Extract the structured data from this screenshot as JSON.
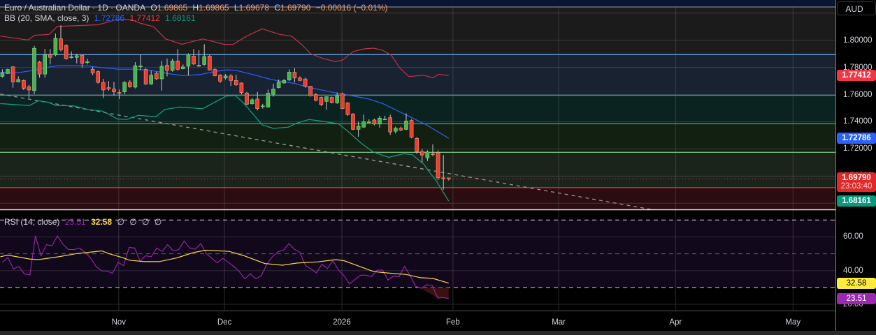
{
  "header": {
    "symbol": "Euro / Australian Dollar · 1D · OANDA",
    "o_label": "O",
    "o": "1.69865",
    "h_label": "H",
    "h": "1.69865",
    "l_label": "L",
    "l": "1.69678",
    "c_label": "C",
    "c": "1.69790",
    "change": "−0.00016 (−0.01%)"
  },
  "bb_legend": {
    "label": "BB (20, SMA, close, 3)",
    "basis": "1.72786",
    "upper": "1.77412",
    "lower": "1.68161"
  },
  "rsi_legend": {
    "label": "RSI (14, close)",
    "rsi": "23.51",
    "ma": "32.58",
    "extra": [
      "∅",
      "∅",
      "∅",
      "∅"
    ]
  },
  "price_axis": {
    "currency": "AUD",
    "ticks": [
      "1.80000",
      "1.78000",
      "1.76000",
      "1.74000",
      "1.72000",
      "1.70000"
    ],
    "tick_values": [
      1.8,
      1.78,
      1.76,
      1.74,
      1.72,
      1.7
    ],
    "badges": [
      {
        "value": "1.77412",
        "color": "#f23645"
      },
      {
        "value": "1.72786",
        "color": "#2962ff"
      },
      {
        "value": "1.69790",
        "countdown": "23:03:40",
        "color": "#e02a2a"
      },
      {
        "value": "1.68161",
        "color": "#089981"
      }
    ]
  },
  "rsi_axis": {
    "ticks": [
      "60.00",
      "40.00",
      "20.00"
    ],
    "tick_values": [
      60,
      40,
      20
    ],
    "badges": [
      {
        "value": "32.58",
        "color": "#ffeb3b",
        "text_color": "#000000"
      },
      {
        "value": "23.51",
        "color": "#9c27b0",
        "text_color": "#ffffff"
      }
    ]
  },
  "time_axis": {
    "labels": [
      "Nov",
      "Dec",
      "2026",
      "Feb",
      "Mar",
      "Apr",
      "May"
    ],
    "label_bar_index": [
      21.9,
      41.8,
      63.9,
      84.8,
      104.7,
      126.7,
      148.8
    ]
  },
  "colors": {
    "up": "#4caf50",
    "down": "#f23a2a",
    "wick": "#c8c8c8",
    "upper": "#c2334a",
    "basis": "#2962ff",
    "lower": "#16a085",
    "rsi": "#9c27b0",
    "rsi_ma": "#f5d547"
  },
  "chart_data": {
    "type": "candlestick",
    "title": "Euro / Australian Dollar · 1D · OANDA",
    "ylim": [
      1.6755,
      1.8245
    ],
    "zones": [
      {
        "from": 1.7895,
        "to": 1.83,
        "color": "#1b1b1b",
        "line": "#1b1b1b"
      },
      {
        "from": 1.7595,
        "to": 1.7895,
        "color": "#182230",
        "line": "#64b5f6"
      },
      {
        "from": 1.7385,
        "to": 1.7595,
        "color": "#0b2320",
        "line": "#26a69a"
      },
      {
        "from": 1.7175,
        "to": 1.7385,
        "color": "#122012",
        "line": "#4caf50"
      },
      {
        "from": 1.6915,
        "to": 1.7175,
        "color": "#1b241b",
        "line": "#81c784"
      },
      {
        "from": 1.6,
        "to": 1.6915,
        "color": "#2a0c11",
        "line": "#e53935"
      }
    ],
    "ohlc": [
      [
        1.7734,
        1.7786,
        1.7725,
        1.776
      ],
      [
        1.7755,
        1.779,
        1.7751,
        1.7785
      ],
      [
        1.7804,
        1.7809,
        1.7651,
        1.7693
      ],
      [
        1.7693,
        1.7734,
        1.769,
        1.7711
      ],
      [
        1.7704,
        1.7711,
        1.7634,
        1.7646
      ],
      [
        1.7658,
        1.7672,
        1.7576,
        1.7634
      ],
      [
        1.7629,
        1.7958,
        1.7602,
        1.7941
      ],
      [
        1.7839,
        1.7848,
        1.7725,
        1.7751
      ],
      [
        1.7751,
        1.7936,
        1.7725,
        1.7892
      ],
      [
        1.7892,
        1.7936,
        1.7822,
        1.7874
      ],
      [
        1.7892,
        1.805,
        1.7883,
        1.8015
      ],
      [
        1.8011,
        1.8111,
        1.7918,
        1.793
      ],
      [
        1.7962,
        1.7971,
        1.7857,
        1.7865
      ],
      [
        1.7874,
        1.7918,
        1.7865,
        1.7878
      ],
      [
        1.7874,
        1.79,
        1.783,
        1.7886
      ],
      [
        1.789,
        1.7892,
        1.7799,
        1.783
      ],
      [
        1.7839,
        1.7865,
        1.7822,
        1.7842
      ],
      [
        1.7786,
        1.7804,
        1.7743,
        1.776
      ],
      [
        1.7769,
        1.7778,
        1.7681,
        1.769
      ],
      [
        1.769,
        1.7716,
        1.7576,
        1.7634
      ],
      [
        1.7651,
        1.7699,
        1.7629,
        1.7641
      ],
      [
        1.7641,
        1.7693,
        1.7593,
        1.762
      ],
      [
        1.7615,
        1.7637,
        1.7567,
        1.7613
      ],
      [
        1.762,
        1.7699,
        1.7602,
        1.769
      ],
      [
        1.769,
        1.7707,
        1.7651,
        1.7658
      ],
      [
        1.7655,
        1.7839,
        1.7646,
        1.7813
      ],
      [
        1.7809,
        1.7892,
        1.7778,
        1.7811
      ],
      [
        1.7785,
        1.7795,
        1.7672,
        1.7678
      ],
      [
        1.7678,
        1.7778,
        1.7672,
        1.7743
      ],
      [
        1.7757,
        1.7769,
        1.7707,
        1.7716
      ],
      [
        1.7716,
        1.7848,
        1.7629,
        1.7809
      ],
      [
        1.7816,
        1.7865,
        1.7734,
        1.7778
      ],
      [
        1.7778,
        1.7865,
        1.7769,
        1.7848
      ],
      [
        1.7848,
        1.7936,
        1.7778,
        1.7786
      ],
      [
        1.779,
        1.7822,
        1.7786,
        1.7804
      ],
      [
        1.7809,
        1.7904,
        1.7739,
        1.7895
      ],
      [
        1.7883,
        1.7936,
        1.7816,
        1.7825
      ],
      [
        1.7816,
        1.7927,
        1.7804,
        1.7809
      ],
      [
        1.7822,
        1.7971,
        1.7813,
        1.788
      ],
      [
        1.7883,
        1.7892,
        1.7778,
        1.7781
      ],
      [
        1.7785,
        1.7795,
        1.7734,
        1.7739
      ],
      [
        1.7743,
        1.7751,
        1.7686,
        1.7699
      ],
      [
        1.7722,
        1.7751,
        1.7711,
        1.7737
      ],
      [
        1.7737,
        1.7751,
        1.7664,
        1.7704
      ],
      [
        1.7704,
        1.7746,
        1.7664,
        1.7672
      ],
      [
        1.7685,
        1.769,
        1.7602,
        1.7615
      ],
      [
        1.7611,
        1.762,
        1.7523,
        1.7529
      ],
      [
        1.7532,
        1.7576,
        1.7527,
        1.7562
      ],
      [
        1.7567,
        1.762,
        1.7483,
        1.7497
      ],
      [
        1.7515,
        1.7532,
        1.7497,
        1.7517
      ],
      [
        1.7508,
        1.7637,
        1.7506,
        1.7611
      ],
      [
        1.7602,
        1.7681,
        1.7585,
        1.7641
      ],
      [
        1.7651,
        1.7711,
        1.7646,
        1.7693
      ],
      [
        1.7685,
        1.7716,
        1.7681,
        1.7704
      ],
      [
        1.7707,
        1.7786,
        1.7699,
        1.7765
      ],
      [
        1.7764,
        1.7795,
        1.769,
        1.7722
      ],
      [
        1.7722,
        1.7734,
        1.7699,
        1.7704
      ],
      [
        1.7715,
        1.7725,
        1.7651,
        1.7662
      ],
      [
        1.7662,
        1.7664,
        1.7585,
        1.7592
      ],
      [
        1.7599,
        1.7611,
        1.755,
        1.7558
      ],
      [
        1.7579,
        1.7585,
        1.7515,
        1.7527
      ],
      [
        1.755,
        1.7585,
        1.7488,
        1.7585
      ],
      [
        1.7579,
        1.7585,
        1.7536,
        1.7541
      ],
      [
        1.7539,
        1.7616,
        1.7532,
        1.7593
      ],
      [
        1.7606,
        1.7615,
        1.7494,
        1.7497
      ],
      [
        1.7539,
        1.7546,
        1.7444,
        1.7453
      ],
      [
        1.7458,
        1.7462,
        1.7339,
        1.7344
      ],
      [
        1.7344,
        1.74,
        1.729,
        1.7369
      ],
      [
        1.736,
        1.7453,
        1.7357,
        1.74
      ],
      [
        1.7397,
        1.7418,
        1.7392,
        1.7399
      ],
      [
        1.7413,
        1.7423,
        1.7374,
        1.7383
      ],
      [
        1.7383,
        1.7444,
        1.7357,
        1.7427
      ],
      [
        1.7418,
        1.7444,
        1.7413,
        1.742
      ],
      [
        1.743,
        1.7453,
        1.7304,
        1.7325
      ],
      [
        1.733,
        1.7365,
        1.7313,
        1.7353
      ],
      [
        1.7353,
        1.7365,
        1.733,
        1.7339
      ],
      [
        1.7344,
        1.7462,
        1.7339,
        1.7406
      ],
      [
        1.7409,
        1.7418,
        1.7278,
        1.7287
      ],
      [
        1.7278,
        1.7287,
        1.7164,
        1.7181
      ],
      [
        1.7181,
        1.7199,
        1.7102,
        1.7155
      ],
      [
        1.7134,
        1.719,
        1.7111,
        1.7178
      ],
      [
        1.7164,
        1.7234,
        1.7146,
        1.7162
      ],
      [
        1.7173,
        1.719,
        1.697,
        1.6987
      ],
      [
        1.6987,
        1.7155,
        1.69,
        1.6985
      ],
      [
        1.69865,
        1.69865,
        1.69678,
        1.6979
      ]
    ],
    "bb_upper": [
      [
        -0.4,
        1.8031
      ],
      [
        4.8,
        1.8002
      ],
      [
        6.1,
        1.8037
      ],
      [
        8.8,
        1.8043
      ],
      [
        10.3,
        1.8101
      ],
      [
        12.7,
        1.8106
      ],
      [
        18.0,
        1.8114
      ],
      [
        21.5,
        1.8152
      ],
      [
        24.2,
        1.8152
      ],
      [
        25.9,
        1.8127
      ],
      [
        28.5,
        1.8099
      ],
      [
        30.7,
        1.801
      ],
      [
        33.8,
        1.797
      ],
      [
        37.7,
        1.801
      ],
      [
        41.7,
        1.797
      ],
      [
        43.4,
        1.7969
      ],
      [
        46.0,
        1.8031
      ],
      [
        48.9,
        1.8084
      ],
      [
        52.2,
        1.8043
      ],
      [
        54.4,
        1.8031
      ],
      [
        56.5,
        1.7963
      ],
      [
        58.0,
        1.7901
      ],
      [
        60.5,
        1.7864
      ],
      [
        62.7,
        1.7843
      ],
      [
        64.0,
        1.7853
      ],
      [
        66.0,
        1.7916
      ],
      [
        68.2,
        1.7937
      ],
      [
        69.9,
        1.7942
      ],
      [
        71.5,
        1.7927
      ],
      [
        73.2,
        1.789
      ],
      [
        74.8,
        1.7796
      ],
      [
        76.5,
        1.7733
      ],
      [
        79.3,
        1.7743
      ],
      [
        81.0,
        1.7723
      ],
      [
        82.1,
        1.7749
      ],
      [
        84.0,
        1.77412
      ]
    ],
    "bb_basis": [
      [
        -0.4,
        1.7764
      ],
      [
        2.8,
        1.7761
      ],
      [
        6.2,
        1.7779
      ],
      [
        9.0,
        1.7805
      ],
      [
        10.6,
        1.7813
      ],
      [
        13.9,
        1.7813
      ],
      [
        16.1,
        1.781
      ],
      [
        18.6,
        1.7799
      ],
      [
        21.7,
        1.7787
      ],
      [
        25.1,
        1.7787
      ],
      [
        28.4,
        1.7775
      ],
      [
        31.7,
        1.7752
      ],
      [
        33.9,
        1.774
      ],
      [
        37.2,
        1.7747
      ],
      [
        40.0,
        1.777
      ],
      [
        42.2,
        1.7782
      ],
      [
        43.9,
        1.7779
      ],
      [
        47.2,
        1.7747
      ],
      [
        50.5,
        1.7712
      ],
      [
        52.7,
        1.7696
      ],
      [
        55.0,
        1.7682
      ],
      [
        57.7,
        1.7653
      ],
      [
        60.5,
        1.763
      ],
      [
        63.8,
        1.7604
      ],
      [
        66.0,
        1.759
      ],
      [
        68.8,
        1.7569
      ],
      [
        71.6,
        1.7534
      ],
      [
        74.3,
        1.7482
      ],
      [
        77.1,
        1.7429
      ],
      [
        79.8,
        1.7377
      ],
      [
        84.0,
        1.72786
      ]
    ],
    "bb_lower": [
      [
        -0.4,
        1.7534
      ],
      [
        2.8,
        1.7525
      ],
      [
        5.1,
        1.752
      ],
      [
        6.8,
        1.7555
      ],
      [
        8.6,
        1.7543
      ],
      [
        10.1,
        1.752
      ],
      [
        13.4,
        1.7517
      ],
      [
        16.1,
        1.7491
      ],
      [
        18.9,
        1.7478
      ],
      [
        21.7,
        1.742
      ],
      [
        23.4,
        1.7417
      ],
      [
        25.6,
        1.7447
      ],
      [
        28.9,
        1.7438
      ],
      [
        30.6,
        1.7491
      ],
      [
        33.4,
        1.7508
      ],
      [
        37.7,
        1.7496
      ],
      [
        40.5,
        1.7555
      ],
      [
        42.2,
        1.759
      ],
      [
        43.9,
        1.7592
      ],
      [
        45.5,
        1.7534
      ],
      [
        47.2,
        1.7455
      ],
      [
        48.9,
        1.7377
      ],
      [
        51.0,
        1.7351
      ],
      [
        53.8,
        1.736
      ],
      [
        55.5,
        1.7391
      ],
      [
        57.7,
        1.7417
      ],
      [
        59.4,
        1.7408
      ],
      [
        63.2,
        1.7386
      ],
      [
        64.9,
        1.7334
      ],
      [
        67.7,
        1.7237
      ],
      [
        69.9,
        1.7176
      ],
      [
        72.7,
        1.7138
      ],
      [
        75.5,
        1.7164
      ],
      [
        77.1,
        1.7159
      ],
      [
        79.3,
        1.7089
      ],
      [
        80.4,
        1.7028
      ],
      [
        81.5,
        1.6975
      ],
      [
        84.0,
        1.68161
      ]
    ],
    "trendline": [
      [
        -0.4,
        1.7604
      ],
      [
        122.6,
        1.6751
      ]
    ],
    "rsi": [
      44.9,
      47.8,
      41.0,
      42.5,
      38.0,
      37.4,
      60.6,
      48.8,
      55.4,
      54.7,
      60.6,
      55.6,
      52.5,
      52.5,
      53.3,
      50.8,
      47.5,
      42.5,
      39.9,
      39.7,
      38.4,
      44.9,
      43.0,
      53.8,
      53.4,
      45.6,
      48.8,
      48.2,
      53.4,
      51.4,
      55.4,
      51.7,
      52.5,
      57.6,
      53.4,
      52.7,
      56.0,
      50.1,
      47.3,
      44.6,
      47.3,
      44.9,
      42.5,
      39.4,
      35.1,
      38.1,
      35.1,
      37.0,
      43.8,
      48.2,
      51.2,
      52.1,
      56.0,
      52.7,
      50.8,
      43.0,
      41.0,
      38.6,
      43.8,
      41.2,
      46.0,
      40.3,
      37.0,
      32.1,
      34.7,
      37.3,
      37.3,
      36.4,
      40.3,
      40.3,
      34.4,
      36.8,
      36.4,
      42.5,
      37.0,
      30.8,
      29.5,
      31.6,
      31.2,
      23.7,
      24.0,
      23.51
    ],
    "rsi_ma": [
      [
        -0.4,
        48.2
      ],
      [
        1.0,
        49.2
      ],
      [
        5.1,
        46.9
      ],
      [
        6.8,
        46.5
      ],
      [
        10.6,
        48.2
      ],
      [
        14.0,
        50.1
      ],
      [
        18.7,
        51.7
      ],
      [
        20.0,
        50.1
      ],
      [
        22.8,
        47.5
      ],
      [
        23.9,
        46.2
      ],
      [
        26.7,
        45.3
      ],
      [
        29.5,
        45.3
      ],
      [
        32.8,
        47.5
      ],
      [
        36.1,
        50.8
      ],
      [
        38.3,
        52.1
      ],
      [
        42.7,
        51.4
      ],
      [
        45.5,
        48.8
      ],
      [
        49.4,
        44.2
      ],
      [
        52.7,
        43.2
      ],
      [
        55.5,
        44.5
      ],
      [
        59.4,
        45.2
      ],
      [
        62.7,
        46.5
      ],
      [
        64.3,
        45.9
      ],
      [
        69.9,
        39.4
      ],
      [
        73.2,
        38.4
      ],
      [
        76.0,
        37.7
      ],
      [
        78.7,
        35.8
      ],
      [
        81.0,
        35.4
      ],
      [
        84.0,
        32.58
      ]
    ],
    "rsi_levels": [
      70,
      50,
      30
    ],
    "rsi_ylim": [
      16.3,
      75.9
    ]
  }
}
